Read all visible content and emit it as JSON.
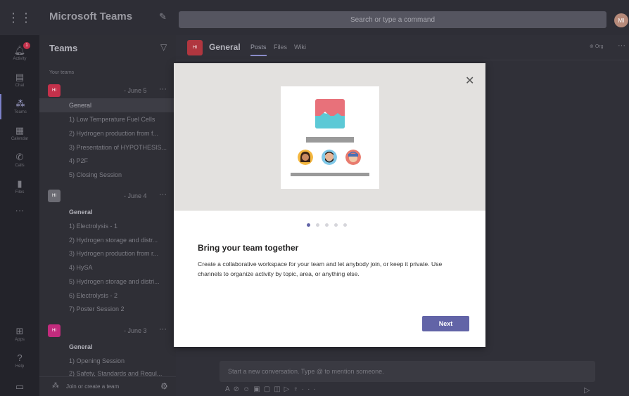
{
  "topbar": {
    "app_title": "Microsoft Teams",
    "search_placeholder": "Search or type a command",
    "avatar_initials": "MI"
  },
  "rail": {
    "items": [
      {
        "label": "Activity",
        "icon": "bell-icon",
        "badge": "1"
      },
      {
        "label": "Chat",
        "icon": "chat-icon"
      },
      {
        "label": "Teams",
        "icon": "teams-icon"
      },
      {
        "label": "Calendar",
        "icon": "calendar-icon"
      },
      {
        "label": "Calls",
        "icon": "phone-icon"
      },
      {
        "label": "Files",
        "icon": "file-icon"
      },
      {
        "label": "",
        "icon": "more-icon"
      }
    ],
    "bottom": [
      {
        "label": "Apps",
        "icon": "apps-icon"
      },
      {
        "label": "Help",
        "icon": "help-icon"
      }
    ]
  },
  "panel": {
    "title": "Teams",
    "section_label": "Your teams",
    "teams": [
      {
        "name": "- June 5",
        "logo": "HI",
        "logo_color": "#c4314b",
        "channels": [
          "General",
          "1) Low Temperature Fuel Cells",
          "2) Hydrogen production from f...",
          "3) Presentation of HYPOTHESIS...",
          "4) P2F",
          "5) Closing Session"
        ]
      },
      {
        "name": "- June 4",
        "logo": "HI",
        "logo_color": "#6b6b73",
        "channels": [
          "General",
          "1) Electrolysis - 1",
          "2) Hydrogen storage and distr...",
          "3) Hydrogen production from r...",
          "4) HySA",
          "5) Hydrogen storage and distri...",
          "6) Electrolysis - 2",
          "7) Poster Session 2"
        ]
      },
      {
        "name": "- June 3",
        "logo": "HI",
        "logo_color": "#c22b7d",
        "channels": [
          "General",
          "1) Opening Session",
          "2) Safety, Standards and Regul..."
        ]
      }
    ],
    "footer_label": "Join or create a team"
  },
  "main": {
    "channel_title": "General",
    "channel_logo": "HI",
    "tabs": [
      "Posts",
      "Files",
      "Wiki"
    ],
    "org_label": "Org",
    "compose_placeholder": "Start a new conversation. Type @ to mention someone."
  },
  "dialog": {
    "title": "Bring your team together",
    "body": "Create a collaborative workspace for your team and let anybody join, or keep it private. Use channels to organize activity by topic, area, or anything else.",
    "next_label": "Next",
    "pager": {
      "count": 5,
      "active": 0
    }
  },
  "colors": {
    "accent": "#6264a7",
    "hero_bg": "#e3e1df"
  }
}
